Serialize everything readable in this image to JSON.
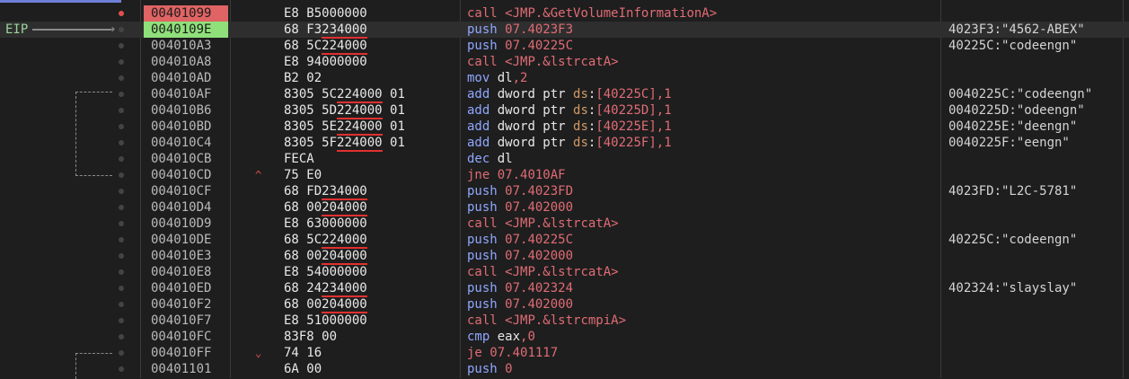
{
  "eip_label": "EIP",
  "rows": [
    {
      "addr": "00401099",
      "bp": true,
      "bytes": "E8 B5000000",
      "m": "call",
      "ops": "<JMP.&GetVolumeInformationA>",
      "cmt": ""
    },
    {
      "addr": "0040109E",
      "eip": true,
      "bytes": "68 F3234000",
      "m": "push",
      "ops": "07.4023F3",
      "cmt": "4023F3:\"4562-ABEX\""
    },
    {
      "addr": "004010A3",
      "bytes": "68 5C224000",
      "m": "push",
      "ops": "07.40225C",
      "cmt": "40225C:\"codeengn\""
    },
    {
      "addr": "004010A8",
      "bytes": "E8 94000000",
      "m": "call",
      "ops": "<JMP.&lstrcatA>",
      "cmt": ""
    },
    {
      "addr": "004010AD",
      "bytes": "B2 02",
      "m": "mov",
      "ops": "dl,2",
      "cmt": ""
    },
    {
      "addr": "004010AF",
      "bytes": "8305 5C224000 01",
      "m": "add",
      "ops": "dword ptr ds:[40225C],1",
      "cmt": "0040225C:\"codeengn\""
    },
    {
      "addr": "004010B6",
      "bytes": "8305 5D224000 01",
      "m": "add",
      "ops": "dword ptr ds:[40225D],1",
      "cmt": "0040225D:\"odeengn\""
    },
    {
      "addr": "004010BD",
      "bytes": "8305 5E224000 01",
      "m": "add",
      "ops": "dword ptr ds:[40225E],1",
      "cmt": "0040225E:\"deengn\""
    },
    {
      "addr": "004010C4",
      "bytes": "8305 5F224000 01",
      "m": "add",
      "ops": "dword ptr ds:[40225F],1",
      "cmt": "0040225F:\"eengn\""
    },
    {
      "addr": "004010CB",
      "bytes": "FECA",
      "m": "dec",
      "ops": "dl",
      "cmt": ""
    },
    {
      "addr": "004010CD",
      "bytes": "75 E0",
      "m": "jne",
      "ops": "07.4010AF",
      "cmt": "",
      "jmp": "^"
    },
    {
      "addr": "004010CF",
      "bytes": "68 FD234000",
      "m": "push",
      "ops": "07.4023FD",
      "cmt": "4023FD:\"L2C-5781\""
    },
    {
      "addr": "004010D4",
      "bytes": "68 00204000",
      "m": "push",
      "ops": "07.402000",
      "cmt": ""
    },
    {
      "addr": "004010D9",
      "bytes": "E8 63000000",
      "m": "call",
      "ops": "<JMP.&lstrcatA>",
      "cmt": ""
    },
    {
      "addr": "004010DE",
      "bytes": "68 5C224000",
      "m": "push",
      "ops": "07.40225C",
      "cmt": "40225C:\"codeengn\""
    },
    {
      "addr": "004010E3",
      "bytes": "68 00204000",
      "m": "push",
      "ops": "07.402000",
      "cmt": ""
    },
    {
      "addr": "004010E8",
      "bytes": "E8 54000000",
      "m": "call",
      "ops": "<JMP.&lstrcatA>",
      "cmt": ""
    },
    {
      "addr": "004010ED",
      "bytes": "68 24234000",
      "m": "push",
      "ops": "07.402324",
      "cmt": "402324:\"slayslay\""
    },
    {
      "addr": "004010F2",
      "bytes": "68 00204000",
      "m": "push",
      "ops": "07.402000",
      "cmt": ""
    },
    {
      "addr": "004010F7",
      "bytes": "E8 51000000",
      "m": "call",
      "ops": "<JMP.&lstrcmpiA>",
      "cmt": ""
    },
    {
      "addr": "004010FC",
      "bytes": "83F8 00",
      "m": "cmp",
      "ops": "eax,0",
      "cmt": ""
    },
    {
      "addr": "004010FF",
      "bytes": "74 16",
      "m": "je",
      "ops": "07.401117",
      "cmt": "",
      "jmp": "v"
    },
    {
      "addr": "00401101",
      "bytes": "6A 00",
      "m": "push",
      "ops": "0",
      "cmt": ""
    }
  ],
  "colors": {
    "breakpoint": "#e06464",
    "eip": "#8fe07a",
    "call": "#e06c75",
    "push": "#8fa7ff"
  }
}
